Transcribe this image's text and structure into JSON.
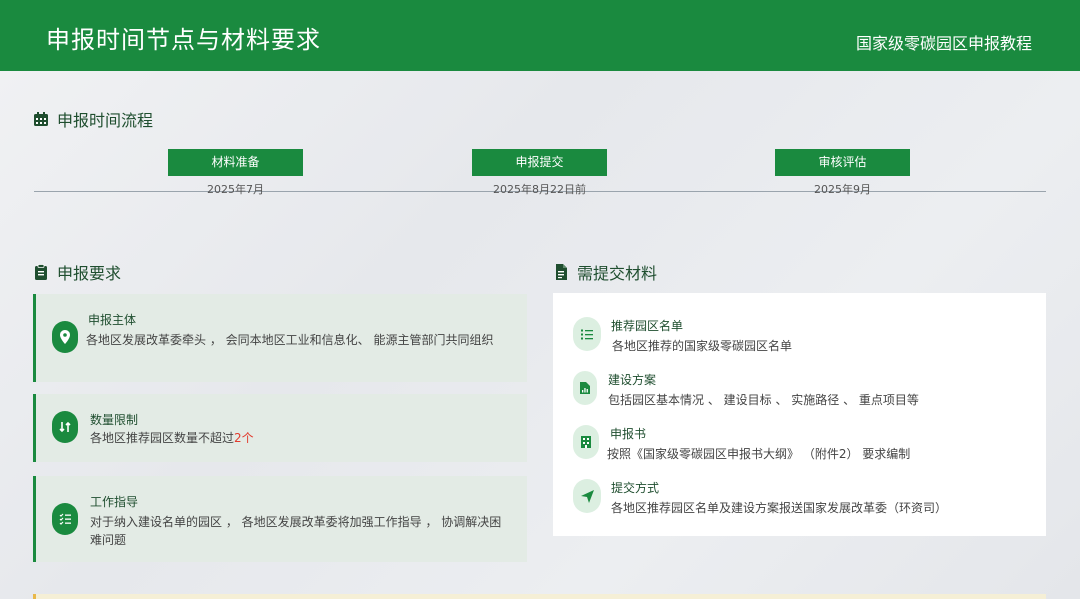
{
  "header": {
    "title": "申报时间节点与材料要求",
    "subtitle": "国家级零碳园区申报教程"
  },
  "timeline": {
    "heading": "申报时间流程",
    "nodes": [
      {
        "label": "材料准备",
        "date": "2025年7月"
      },
      {
        "label": "申报提交",
        "date": "2025年8月22日前"
      },
      {
        "label": "审核评估",
        "date": "2025年9月"
      }
    ]
  },
  "requirements": {
    "heading": "申报要求",
    "items": [
      {
        "title": "申报主体",
        "desc": "各地区发展改革委牵头 ， 会同本地区工业和信息化、 能源主管部门共同组织",
        "icon": "location-pin-icon"
      },
      {
        "title": "数量限制",
        "desc_prefix": "各地区推荐园区数量不超过",
        "desc_highlight": "2个",
        "icon": "sort-arrows-icon"
      },
      {
        "title": "工作指导",
        "desc": "对于纳入建设名单的园区 ， 各地区发展改革委将加强工作指导 ， 协调解决困难问题",
        "icon": "checklist-icon"
      }
    ]
  },
  "materials": {
    "heading": "需提交材料",
    "items": [
      {
        "title": "推荐园区名单",
        "desc": "各地区推荐的国家级零碳园区名单",
        "icon": "list-icon"
      },
      {
        "title": "建设方案",
        "desc": "包括园区基本情况 、 建设目标 、 实施路径 、 重点项目等",
        "icon": "file-chart-icon"
      },
      {
        "title": "申报书",
        "desc": "按照《国家级零碳园区申报书大纲》 （附件2） 要求编制",
        "icon": "building-icon"
      },
      {
        "title": "提交方式",
        "desc": "各地区推荐园区名单及建设方案报送国家发展改革委（环资司）",
        "icon": "send-icon"
      }
    ]
  },
  "colors": {
    "brand": "#1a8a3f",
    "highlight": "#e23b2e"
  }
}
